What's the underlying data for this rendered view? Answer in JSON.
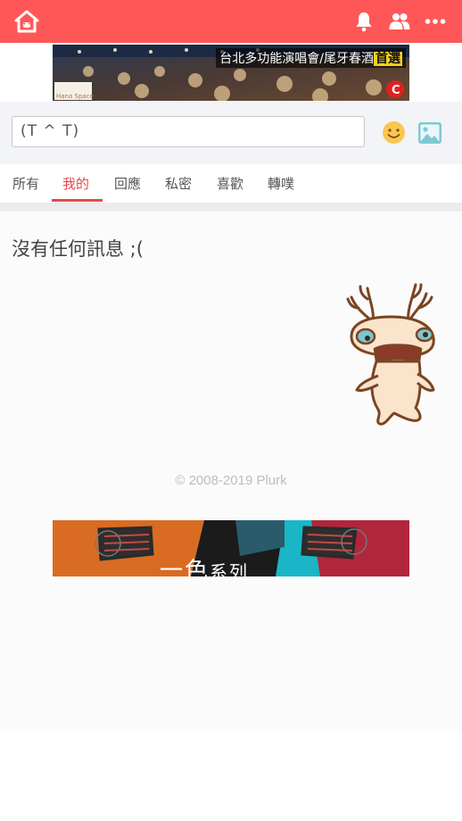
{
  "header": {
    "icons": [
      "home-icon",
      "bell-icon",
      "friends-icon",
      "more-icon"
    ],
    "bg_color": "#ff5757"
  },
  "ad_top": {
    "text": "台北多功能演唱會/尾牙春酒",
    "highlight": "首選",
    "venue": "Hana Space"
  },
  "composer": {
    "value": "(T ^ T)",
    "smiley_icon": "smiley-icon",
    "image_icon": "image-icon"
  },
  "tabs": [
    {
      "label": "所有",
      "active": false
    },
    {
      "label": "我的",
      "active": true
    },
    {
      "label": "回應",
      "active": false
    },
    {
      "label": "私密",
      "active": false
    },
    {
      "label": "喜歡",
      "active": false
    },
    {
      "label": "轉噗",
      "active": false
    }
  ],
  "main": {
    "empty_message": "沒有任何訊息 ;(",
    "copyright": "© 2008-2019 Plurk"
  },
  "ad_bottom": {
    "text": "一色",
    "small": "系列"
  },
  "colors": {
    "accent": "#e8484b",
    "composer_bg": "#f2f4f7"
  }
}
